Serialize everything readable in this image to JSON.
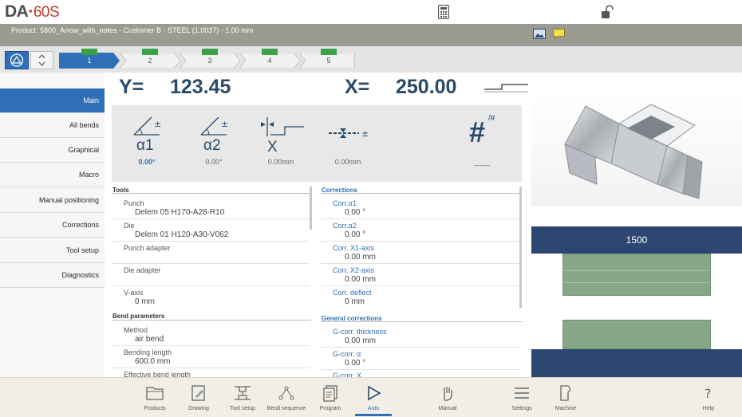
{
  "app": {
    "logo_brand": "DA",
    "logo_model": "60S"
  },
  "product_bar": {
    "label": "Product: 5800_Arrow_with_notes - Customer B - STEEL (1.0037) - 1.00 mm"
  },
  "steps": [
    {
      "label": "1",
      "active": true
    },
    {
      "label": "2",
      "active": false
    },
    {
      "label": "3",
      "active": false
    },
    {
      "label": "4",
      "active": false
    },
    {
      "label": "5",
      "active": false
    }
  ],
  "sidebar": {
    "items": [
      {
        "label": "Main",
        "active": true
      },
      {
        "label": "All bends",
        "active": false
      },
      {
        "label": "Graphical",
        "active": false
      },
      {
        "label": "Macro",
        "active": false
      },
      {
        "label": "Manual positioning",
        "active": false
      },
      {
        "label": "Corrections",
        "active": false
      },
      {
        "label": "Tool setup",
        "active": false
      },
      {
        "label": "Diagnostics",
        "active": false
      }
    ]
  },
  "axes": {
    "y_label": "Y=",
    "y_value": "123.45",
    "x_label": "X=",
    "x_value": "250.00"
  },
  "info": {
    "a1_symbol": "α1",
    "a1_value": "0.00°",
    "a2_symbol": "α2",
    "a2_value": "0.00°",
    "x_symbol": "X",
    "x_value": "0.00mm",
    "deflect_value": "0.00mm",
    "count_symbol": "#",
    "count_sup": "/#",
    "count_value": "____"
  },
  "tools": {
    "header": "Tools",
    "rows": [
      {
        "label": "Punch",
        "value": "Delem 05 H170-A28-R10"
      },
      {
        "label": "Die",
        "value": "Delem 01 H120-A30-V062"
      },
      {
        "label": "Punch adapter",
        "value": ""
      },
      {
        "label": "Die adapter",
        "value": ""
      },
      {
        "label": "V-axis",
        "value": "0 mm"
      }
    ]
  },
  "bend_params": {
    "header": "Bend parameters",
    "rows": [
      {
        "label": "Method",
        "value": "air bend"
      },
      {
        "label": "Bending length",
        "value": "600.0 mm"
      },
      {
        "label": "Effective bend length",
        "value": ""
      }
    ]
  },
  "corrections": {
    "header": "Corrections",
    "rows": [
      {
        "label": "Corr.α1",
        "value": "0.00 °"
      },
      {
        "label": "Corr.α2",
        "value": "0.00 °"
      },
      {
        "label": "Corr. X1-axis",
        "value": "0.00 mm"
      },
      {
        "label": "Corr. X2-axis",
        "value": "0.00 mm"
      },
      {
        "label": "Corr. deflect",
        "value": "0 mm"
      }
    ]
  },
  "general_corrections": {
    "header": "General corrections",
    "rows": [
      {
        "label": "G-corr. thickness",
        "value": "0.00 mm"
      },
      {
        "label": "G-corr. α",
        "value": "0.00 °"
      },
      {
        "label": "G-corr. X",
        "value": ""
      }
    ]
  },
  "tool_setup_view": {
    "length_label": "1500"
  },
  "toolbar": {
    "items": [
      {
        "label": "Products",
        "icon": "folder-icon"
      },
      {
        "label": "Drawing",
        "icon": "drawing-icon"
      },
      {
        "label": "Tool setup",
        "icon": "tool-setup-icon"
      },
      {
        "label": "Bend sequence",
        "icon": "bend-sequence-icon"
      },
      {
        "label": "Program",
        "icon": "program-icon"
      },
      {
        "label": "Auto",
        "icon": "play-icon"
      },
      {
        "label": "Manual",
        "icon": "hand-icon"
      },
      {
        "label": "Settings",
        "icon": "settings-icon"
      },
      {
        "label": "Machine",
        "icon": "machine-icon"
      },
      {
        "label": "Help",
        "icon": "help-icon"
      }
    ]
  },
  "colors": {
    "accent": "#2f6fb7",
    "product_bar": "#9c9b92",
    "tool_bar": "#2c4571",
    "tool_block": "#87a886",
    "step_mark": "#3aa04a"
  }
}
